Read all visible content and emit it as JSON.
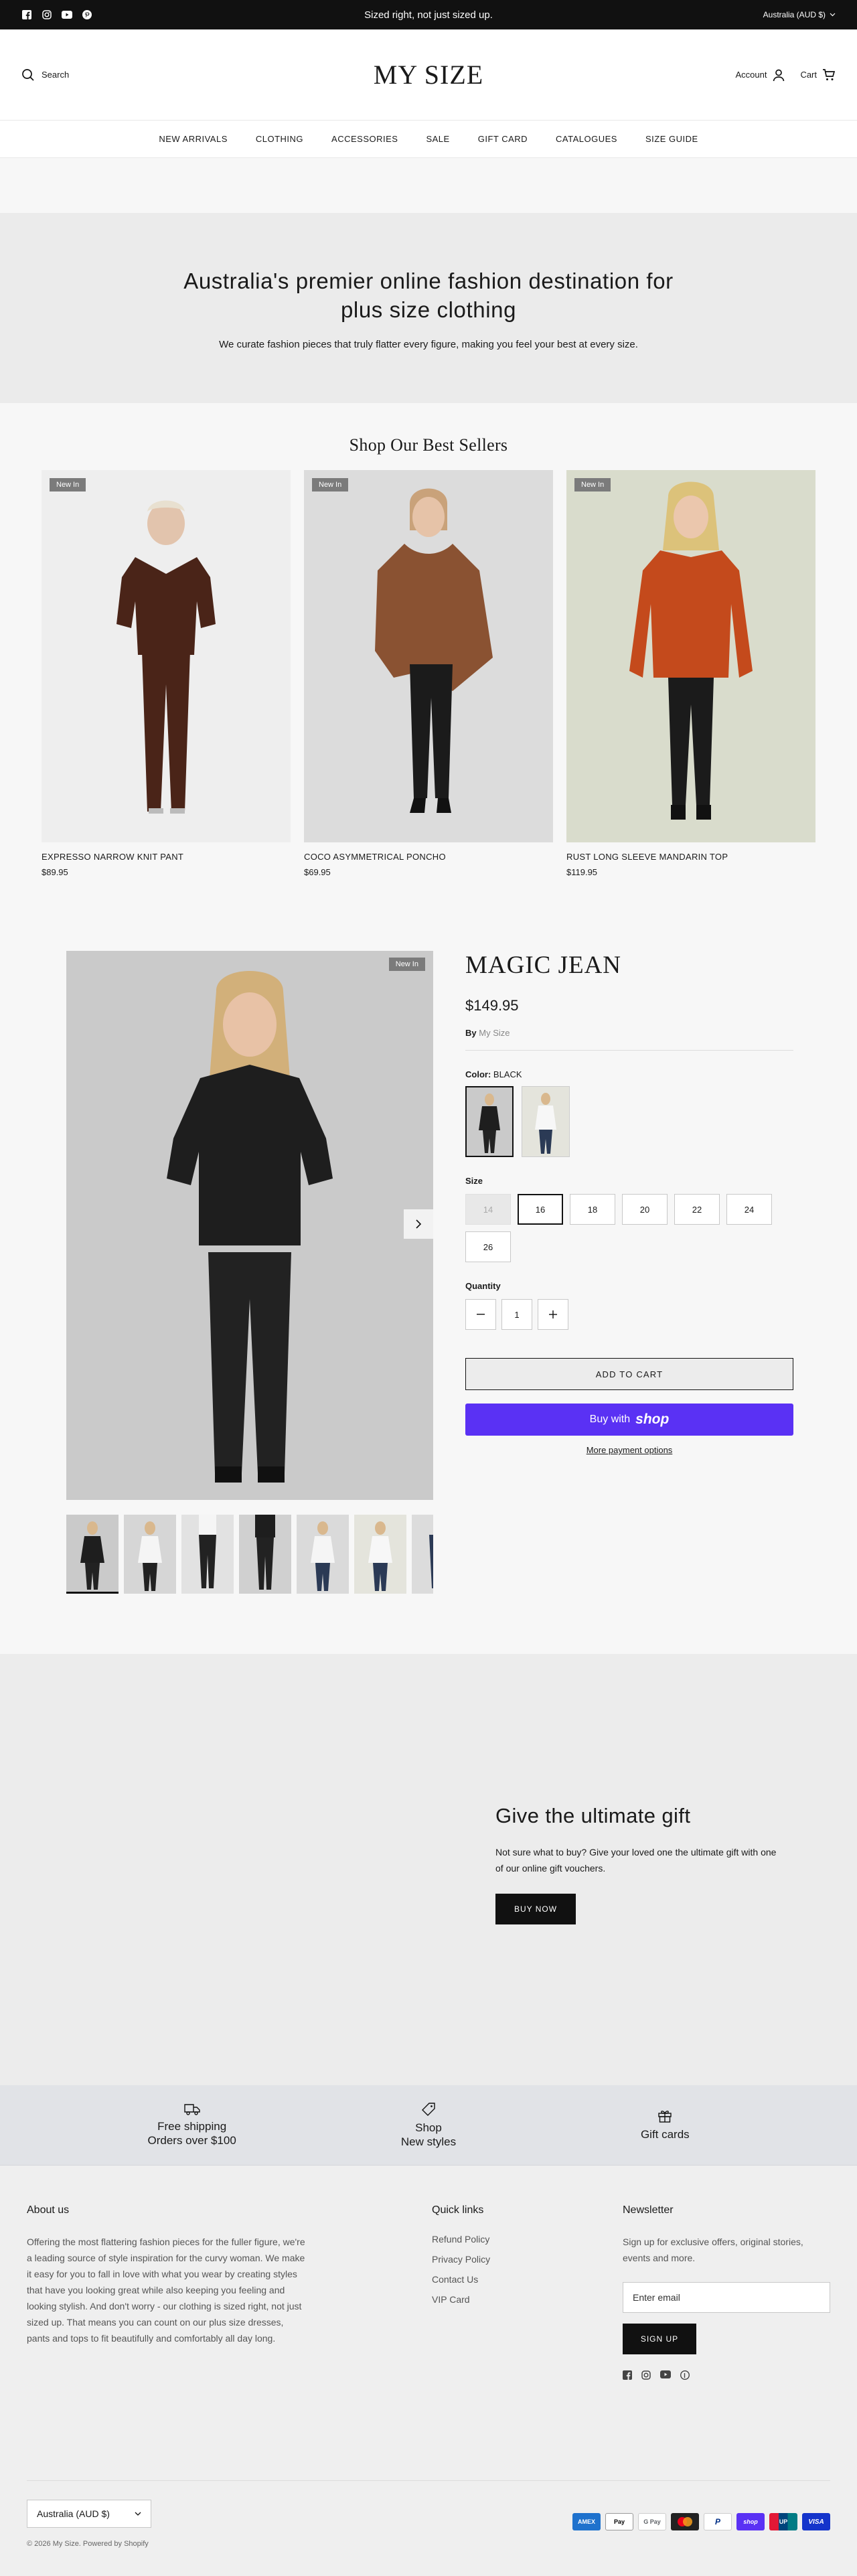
{
  "announcement": {
    "message": "Sized right, not just sized up.",
    "country": "Australia (AUD $)",
    "social_icons": [
      "facebook-icon",
      "instagram-icon",
      "youtube-icon",
      "pinterest-icon"
    ]
  },
  "header": {
    "search_label": "Search",
    "logo": "MY SIZE",
    "account_label": "Account",
    "cart_label": "Cart"
  },
  "nav": {
    "items": [
      "NEW ARRIVALS",
      "CLOTHING",
      "ACCESSORIES",
      "SALE",
      "GIFT CARD",
      "CATALOGUES",
      "SIZE GUIDE"
    ]
  },
  "hero": {
    "title": "Australia's premier online fashion destination for plus size clothing",
    "subtitle": "We curate fashion pieces that truly flatter every figure, making you feel your best at every size."
  },
  "best_sellers": {
    "heading": "Shop Our Best Sellers",
    "products": [
      {
        "badge": "New In",
        "name": "EXPRESSO NARROW KNIT PANT",
        "price": "$89.95"
      },
      {
        "badge": "New In",
        "name": "COCO ASYMMETRICAL PONCHO",
        "price": "$69.95"
      },
      {
        "badge": "New In",
        "name": "RUST LONG SLEEVE MANDARIN TOP",
        "price": "$119.95"
      }
    ]
  },
  "product": {
    "badge": "New In",
    "title": "MAGIC JEAN",
    "price": "$149.95",
    "by_label": "By",
    "vendor": "My Size",
    "color_label": "Color:",
    "color_value": "BLACK",
    "size_label": "Size",
    "sizes": [
      "14",
      "16",
      "18",
      "20",
      "22",
      "24",
      "26"
    ],
    "selected_size": "16",
    "unavailable_sizes": [
      "14"
    ],
    "quantity_label": "Quantity",
    "quantity": "1",
    "add_to_cart": "ADD TO CART",
    "buy_with": "Buy with",
    "shop_brand": "shop",
    "more_payment": "More payment options"
  },
  "gift": {
    "heading": "Give the ultimate gift",
    "text": "Not sure what to buy? Give your loved one the ultimate gift with one of our online gift vouchers.",
    "button": "BUY NOW"
  },
  "features": [
    {
      "icon": "truck-icon",
      "line1": "Free shipping",
      "line2": "Orders over $100"
    },
    {
      "icon": "tag-icon",
      "line1": "Shop",
      "line2": "New styles"
    },
    {
      "icon": "gift-icon",
      "line1": "Gift cards",
      "line2": ""
    }
  ],
  "footer": {
    "about_heading": "About us",
    "about_text": "Offering the most flattering fashion pieces for the fuller figure, we're a leading source of style inspiration for the curvy woman. We make it easy for you to fall in love with what you wear by creating styles that have you looking great while also keeping you feeling and looking stylish. And don't worry - our clothing is sized right, not just sized up. That means you can count on our plus size dresses, pants and tops to fit beautifully and comfortably all day long.",
    "quick_heading": "Quick links",
    "quick_links": [
      "Refund Policy",
      "Privacy Policy",
      "Contact Us",
      "VIP Card"
    ],
    "news_heading": "Newsletter",
    "news_text": "Sign up for exclusive offers, original stories, events and more.",
    "email_placeholder": "Enter email",
    "signup": "SIGN UP",
    "country": "Australia (AUD $)",
    "copyright": "© 2026 My Size. Powered by Shopify",
    "payments": [
      "American Express",
      "Apple Pay",
      "Google Pay",
      "Mastercard",
      "PayPal",
      "Shop Pay",
      "Union Pay",
      "Visa"
    ],
    "payment_labels": [
      "AMEX",
      "Pay",
      "G Pay",
      "",
      "P",
      "shop",
      "UP",
      "VISA"
    ]
  },
  "colors": {
    "announcement_bg": "#111111",
    "shop_pay": "#5a31f4",
    "badge": "#7b7b7b"
  }
}
